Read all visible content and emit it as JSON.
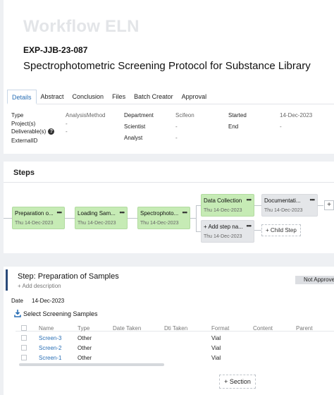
{
  "app": {
    "title": "Workflow ELN"
  },
  "experiment": {
    "id": "EXP-JJB-23-087",
    "title": "Spectrophotometric Screening Protocol for Substance Library"
  },
  "tabs": [
    {
      "label": "Details",
      "active": true
    },
    {
      "label": "Abstract"
    },
    {
      "label": "Conclusion"
    },
    {
      "label": "Files"
    },
    {
      "label": "Batch Creator"
    },
    {
      "label": "Approval"
    }
  ],
  "details": {
    "type_label": "Type",
    "type_value": "AnalysisMethod",
    "projects_label": "Project(s)",
    "projects_value": "-",
    "deliverables_label": "Deliverable(s)",
    "deliverables_value": "-",
    "external_label": "ExternalID",
    "department_label": "Department",
    "department_value": "Scifeon",
    "scientist_label": "Scientist",
    "scientist_value": "-",
    "analyst_label": "Analyst",
    "analyst_value": "-",
    "started_label": "Started",
    "started_value": "14-Dec-2023",
    "end_label": "End",
    "end_value": "-"
  },
  "steps": {
    "title": "Steps",
    "nodes": [
      {
        "name": "Preparation o...",
        "date": "Thu 14-Dec-2023",
        "status": "done"
      },
      {
        "name": "Loading Sam...",
        "date": "Thu 14-Dec-2023",
        "status": "done"
      },
      {
        "name": "Spectrophoto...",
        "date": "Thu 14-Dec-2023",
        "status": "done"
      },
      {
        "name": "Data Collection",
        "date": "Thu 14-Dec-2023",
        "status": "done"
      },
      {
        "name": "Documentati...",
        "date": "Thu 14-Dec-2023",
        "status": "pending"
      },
      {
        "name": "+ Add step na...",
        "date": "Thu 14-Dec-2023",
        "status": "pending"
      }
    ],
    "dots": "•••",
    "child_step_label": "+ Child Step",
    "plus_label": "+"
  },
  "step_detail": {
    "title": "Step:  Preparation of Samples",
    "add_description": "+ Add description",
    "status_button": "Not Approved",
    "date_label": "Date",
    "date_value": "14-Dec-2023",
    "section_title": "Select Screening Samples",
    "columns": [
      "Name",
      "Type",
      "Date Taken",
      "Dti Taken",
      "Format",
      "Content",
      "Parent"
    ],
    "rows": [
      {
        "name": "Screen-3",
        "type": "Other",
        "format": "Vial"
      },
      {
        "name": "Screen-2",
        "type": "Other",
        "format": "Vial"
      },
      {
        "name": "Screen-1",
        "type": "Other",
        "format": "Vial"
      }
    ],
    "add_section_label": "+ Section"
  },
  "colors": {
    "accent": "#2a6fb5",
    "step_done": "#c6ebb5",
    "step_pending": "#e4e6e9"
  }
}
